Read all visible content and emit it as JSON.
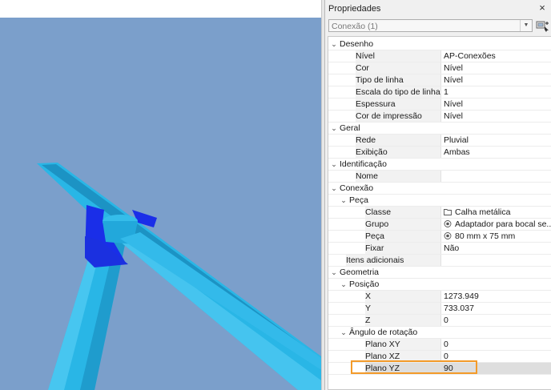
{
  "panel": {
    "title": "Propriedades",
    "close_glyph": "×",
    "selection_value": "Conexão (1)",
    "quick_select_icon": "quick-select-icon"
  },
  "colors": {
    "canvas_bg": "#7b9fcb",
    "pipe_light": "#29b6e6",
    "pipe_dark": "#1a8ab8",
    "fitting_blue": "#1a2ee8",
    "highlight_border": "#f39b2a"
  },
  "rows": [
    {
      "kind": "cat",
      "level": 0,
      "label": "Desenho"
    },
    {
      "kind": "prop",
      "level": 1,
      "label": "Nível",
      "value": "AP-Conexões"
    },
    {
      "kind": "prop",
      "level": 1,
      "label": "Cor",
      "value": "Nível"
    },
    {
      "kind": "prop",
      "level": 1,
      "label": "Tipo de linha",
      "value": "Nível"
    },
    {
      "kind": "prop",
      "level": 1,
      "label": "Escala do tipo de linha",
      "value": "1"
    },
    {
      "kind": "prop",
      "level": 1,
      "label": "Espessura",
      "value": "Nível"
    },
    {
      "kind": "prop",
      "level": 1,
      "label": "Cor de impressão",
      "value": "Nível"
    },
    {
      "kind": "cat",
      "level": 0,
      "label": "Geral"
    },
    {
      "kind": "prop",
      "level": 1,
      "label": "Rede",
      "value": "Pluvial"
    },
    {
      "kind": "prop",
      "level": 1,
      "label": "Exibição",
      "value": "Ambas"
    },
    {
      "kind": "cat",
      "level": 0,
      "label": "Identificação"
    },
    {
      "kind": "prop",
      "level": 1,
      "label": "Nome",
      "value": ""
    },
    {
      "kind": "cat",
      "level": 0,
      "label": "Conexão"
    },
    {
      "kind": "cat",
      "level": 1,
      "label": "Peça"
    },
    {
      "kind": "prop",
      "level": 2,
      "label": "Classe",
      "value": "Calha metálica",
      "icon": "folder-icon"
    },
    {
      "kind": "prop",
      "level": 2,
      "label": "Grupo",
      "value": "Adaptador para bocal se...",
      "icon": "target-icon"
    },
    {
      "kind": "prop",
      "level": 2,
      "label": "Peça",
      "value": "80 mm x 75 mm",
      "icon": "target-icon"
    },
    {
      "kind": "prop",
      "level": 2,
      "label": "Fixar",
      "value": "Não"
    },
    {
      "kind": "prop",
      "level": 0,
      "label": "Itens adicionais",
      "value": ""
    },
    {
      "kind": "cat",
      "level": 0,
      "label": "Geometria"
    },
    {
      "kind": "cat",
      "level": 1,
      "label": "Posição"
    },
    {
      "kind": "prop",
      "level": 2,
      "label": "X",
      "value": "1273.949"
    },
    {
      "kind": "prop",
      "level": 2,
      "label": "Y",
      "value": "733.037"
    },
    {
      "kind": "prop",
      "level": 2,
      "label": "Z",
      "value": "0"
    },
    {
      "kind": "cat",
      "level": 1,
      "label": "Ângulo de rotação"
    },
    {
      "kind": "prop",
      "level": 2,
      "label": "Plano XY",
      "value": "0"
    },
    {
      "kind": "prop",
      "level": 2,
      "label": "Plano XZ",
      "value": "0"
    },
    {
      "kind": "prop",
      "level": 2,
      "label": "Plano YZ",
      "value": "90",
      "highlight": true
    }
  ]
}
